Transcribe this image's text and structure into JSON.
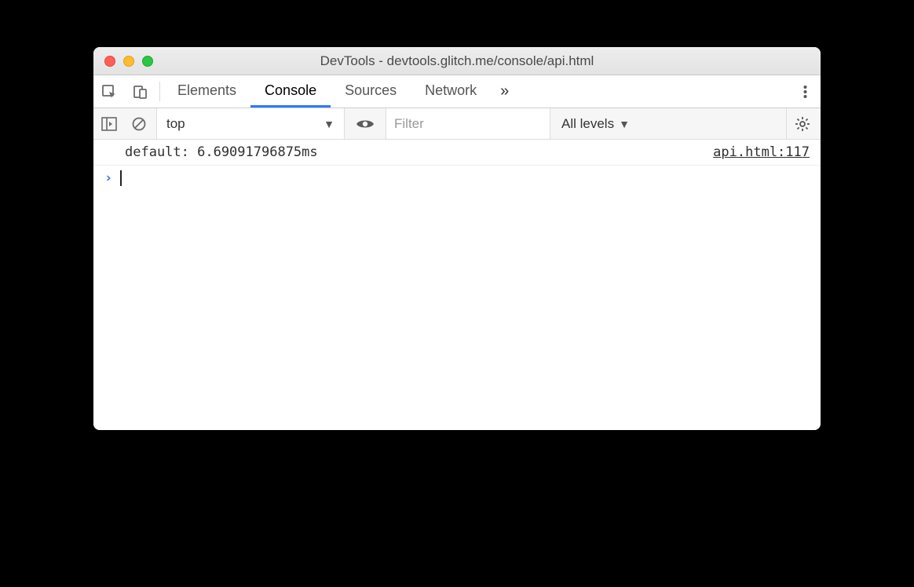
{
  "window": {
    "title": "DevTools - devtools.glitch.me/console/api.html"
  },
  "tabs": {
    "items": [
      "Elements",
      "Console",
      "Sources",
      "Network"
    ],
    "active_index": 1,
    "more_glyph": "»"
  },
  "filterbar": {
    "context": "top",
    "filter_placeholder": "Filter",
    "levels_label": "All levels"
  },
  "console": {
    "rows": [
      {
        "message": "default: 6.69091796875ms",
        "source": "api.html:117"
      }
    ],
    "prompt_glyph": "›"
  }
}
